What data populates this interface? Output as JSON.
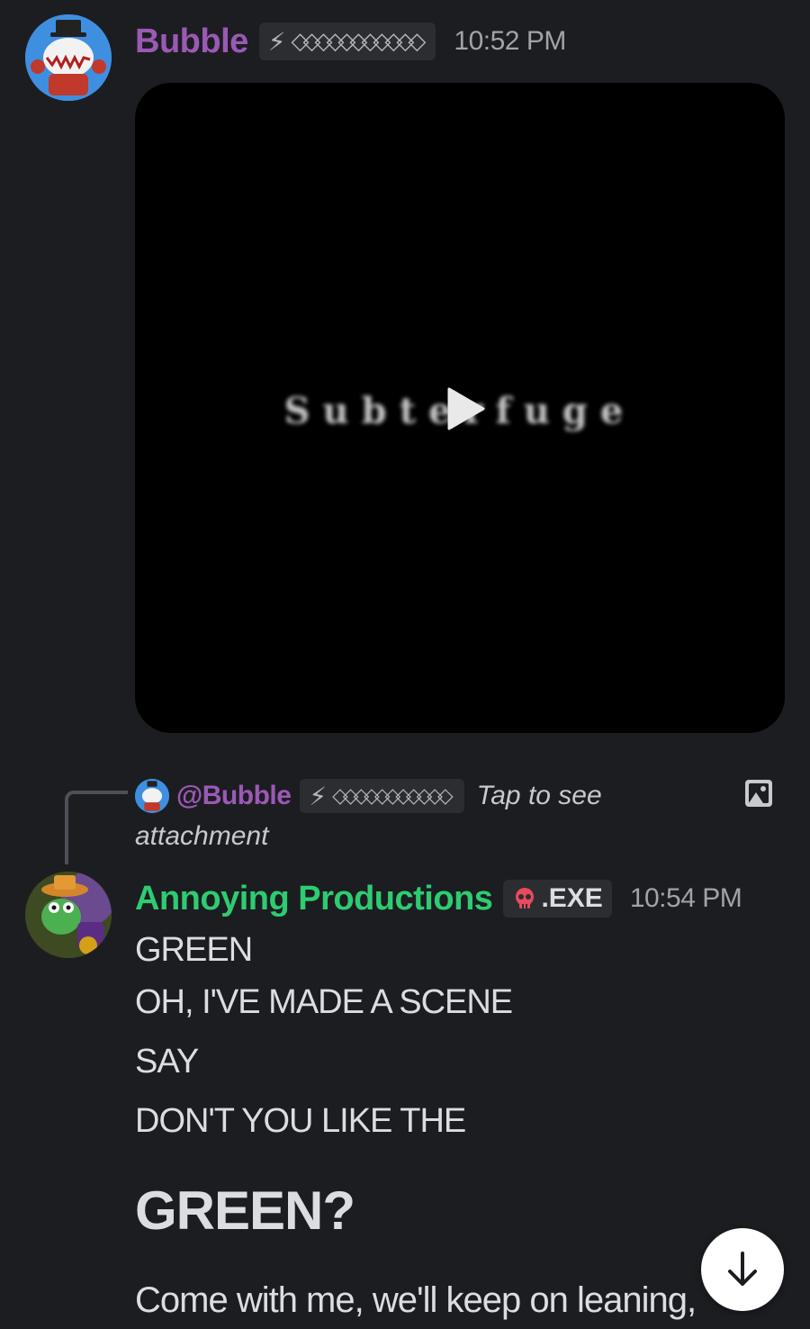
{
  "messages": [
    {
      "author": "Bubble",
      "tag_bolt": "⚡",
      "tag_text": "◇◇◇◇◇◇◇◇◇◇◇",
      "time": "10:52 PM",
      "attachment": {
        "type": "video",
        "overlay_text": "Subterfuge",
        "icon": "play-icon"
      }
    },
    {
      "reply": {
        "author": "@Bubble",
        "tag_bolt": "⚡",
        "tag_text": "◇◇◇◇◇◇◇◇◇◇◇",
        "text_line1": "Tap to see",
        "text_line2": "attachment",
        "icon": "image-icon"
      },
      "author": "Annoying Productions",
      "tag_text": ".EXE",
      "tag_icon": "skull-icon",
      "time": "10:54 PM",
      "lines": [
        "GREEN",
        "OH, I'VE MADE A SCENE",
        "SAY",
        "DON'T YOU LIKE THE",
        "GREEN?",
        "Come with me, we'll keep on leaning,"
      ]
    }
  ],
  "colors": {
    "background": "#1c1d21",
    "bubble_name": "#9b59b6",
    "annoying_name": "#2ecc71",
    "timestamp": "#a0a3a8"
  },
  "scroll_button": {
    "icon": "arrow-down-icon"
  }
}
